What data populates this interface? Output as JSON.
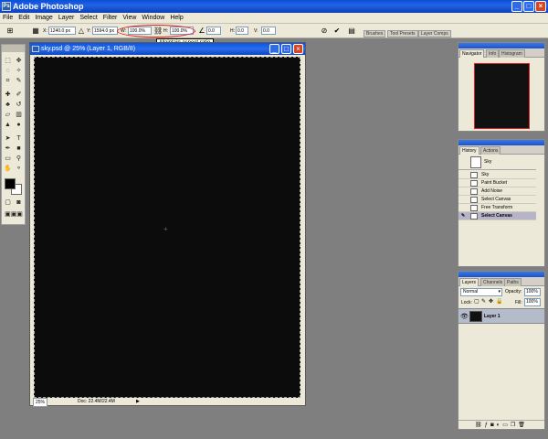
{
  "app": {
    "title": "Adobe Photoshop"
  },
  "menu": [
    "File",
    "Edit",
    "Image",
    "Layer",
    "Select",
    "Filter",
    "View",
    "Window",
    "Help"
  ],
  "options": {
    "x_label": "X:",
    "x_value": "1240.0 px",
    "y_label": "Y:",
    "y_value": "1594.0 px",
    "w_label": "W:",
    "w_value": "100.0%",
    "h_label": "H:",
    "h_value": "100.0%",
    "angle_value": "0.0",
    "hskew_label": "H:",
    "hskew_value": "0.0",
    "vskew_label": "V:",
    "vskew_value": "0.0",
    "tooltip": "Maintain aspect ratio",
    "well_tabs": [
      "Brushes",
      "Tool Presets",
      "Layer Comps"
    ]
  },
  "document": {
    "title": "sky.psd @ 25% (Layer 1, RGB/8)",
    "zoom": "25%",
    "doc_info": "Doc: 22.4M/22.4M"
  },
  "navigator": {
    "tabs": [
      "Navigator",
      "Info",
      "Histogram"
    ]
  },
  "history": {
    "tabs": [
      "History",
      "Actions"
    ],
    "snapshot": "Sky",
    "states": [
      "Sky",
      "Paint Bucket",
      "Add Noise",
      "Select Canvas",
      "Free Transform",
      "Select Canvas"
    ]
  },
  "layers": {
    "tabs": [
      "Layers",
      "Channels",
      "Paths"
    ],
    "blend_mode": "Normal",
    "opacity_label": "Opacity:",
    "opacity_value": "100%",
    "lock_label": "Lock:",
    "fill_label": "Fill:",
    "fill_value": "100%",
    "layer_name": "Layer 1"
  }
}
